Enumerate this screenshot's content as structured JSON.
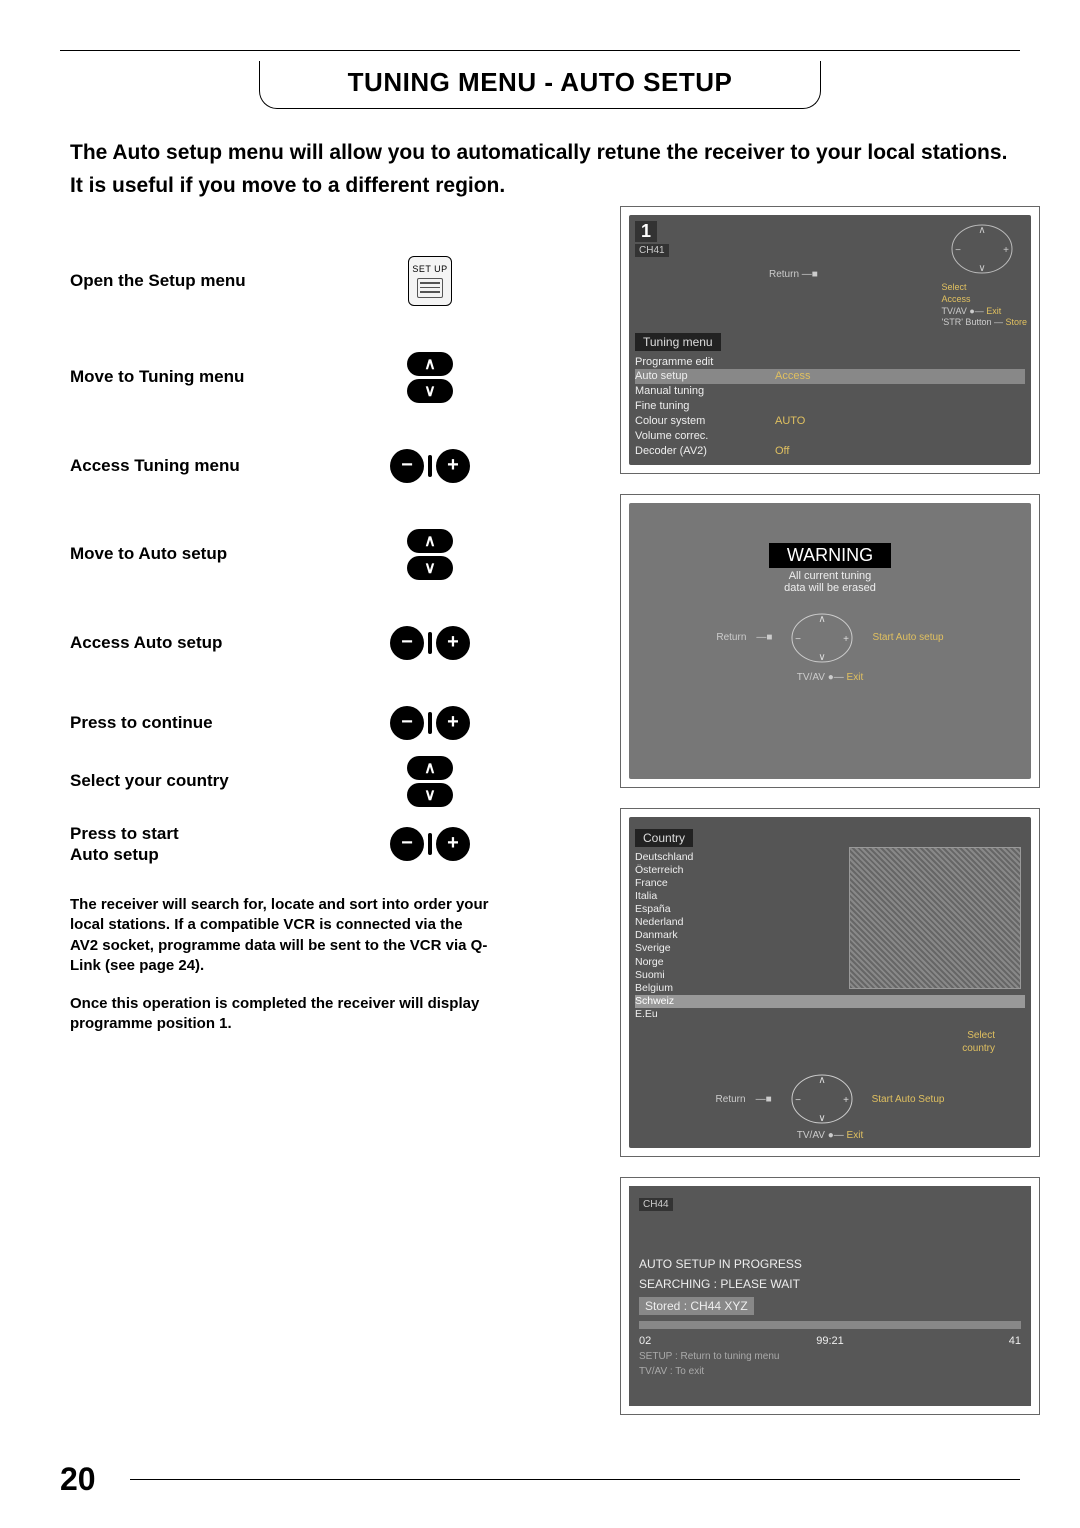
{
  "page_number": "20",
  "title": "TUNING MENU - AUTO SETUP",
  "intro_line1": "The Auto setup menu will allow you to automatically retune the receiver to your local stations.",
  "intro_line2": "It is useful if you move to a different region.",
  "setup_label": "SET UP",
  "steps": {
    "s1": "Open the Setup menu",
    "s2": "Move to Tuning menu",
    "s3": "Access Tuning menu",
    "s4": "Move to Auto setup",
    "s5": "Access Auto setup",
    "s6": "Press to continue",
    "s7": "Select your country",
    "s8a": "Press to start",
    "s8b": "Auto setup"
  },
  "after": {
    "p1": "The receiver will search for, locate and sort into order your local stations. If a compatible VCR is connected via the AV2 socket, programme data will be sent to the VCR via Q-Link (see page 24).",
    "p2": "Once this operation is completed the receiver will display programme position 1."
  },
  "osd1": {
    "num": "1",
    "ch": "CH41",
    "return": "Return",
    "legend_select": "Select",
    "legend_access": "Access",
    "legend_tvav": "TV/AV",
    "legend_exit": "Exit",
    "legend_str": "'STR' Button",
    "legend_store": "Store",
    "tab": "Tuning menu",
    "items": {
      "i1": "Programme edit",
      "i2": "Auto setup",
      "i2v": "Access",
      "i3": "Manual tuning",
      "i4": "Fine tuning",
      "i5": "Colour system",
      "i5v": "AUTO",
      "i6": "Volume correc.",
      "i7": "Decoder (AV2)",
      "i7v": "Off"
    }
  },
  "osd2": {
    "warning": "WARNING",
    "sub1": "All current tuning",
    "sub2": "data will be erased",
    "return": "Return",
    "start": "Start Auto setup",
    "tvav": "TV/AV",
    "exit": "Exit"
  },
  "osd3": {
    "tab": "Country",
    "countries": {
      "c1": "Deutschland",
      "c2": "Österreich",
      "c3": "France",
      "c4": "Italia",
      "c5": "España",
      "c6": "Nederland",
      "c7": "Danmark",
      "c8": "Sverige",
      "c9": "Norge",
      "c10": "Suomi",
      "c11": "Belgium",
      "c12": "Schweiz",
      "c13": "E.Eu"
    },
    "legend_select": "Select",
    "legend_country": "country",
    "legend_start": "Start Auto Setup",
    "return": "Return",
    "tvav": "TV/AV",
    "exit": "Exit"
  },
  "osd4": {
    "ch": "CH44",
    "l1": "AUTO SETUP IN PROGRESS",
    "l2": "SEARCHING : PLEASE WAIT",
    "stored": "Stored : CH44 XYZ",
    "v1": "02",
    "v2": "99:21",
    "v3": "41",
    "h1": "SETUP : Return to tuning menu",
    "h2": "TV/AV : To exit"
  }
}
